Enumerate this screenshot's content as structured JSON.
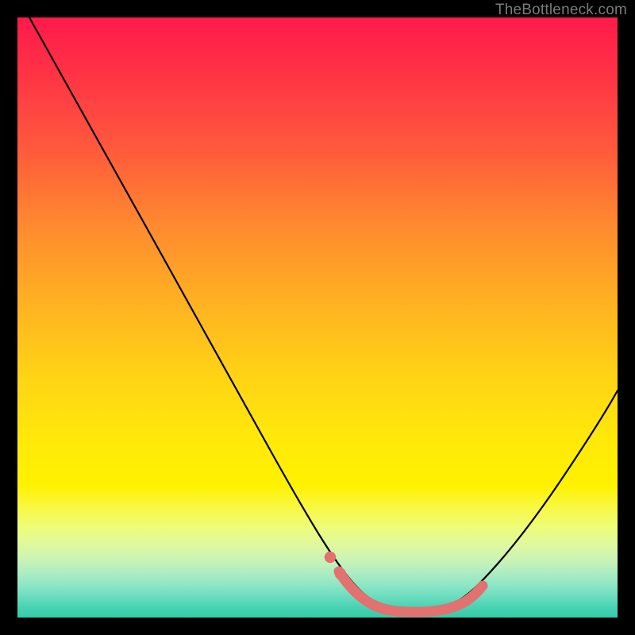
{
  "watermark": {
    "text": "TheBottleneck.com"
  },
  "colors": {
    "background": "#000000",
    "curve": "#000000",
    "highlight": "#e2716f",
    "watermark": "#88898a"
  },
  "chart_data": {
    "type": "line",
    "title": "",
    "xlabel": "",
    "ylabel": "",
    "xlim": [
      0,
      100
    ],
    "ylim": [
      0,
      100
    ],
    "grid": false,
    "legend": false,
    "series": [
      {
        "name": "bottleneck-curve",
        "x": [
          2,
          6,
          10,
          14,
          18,
          22,
          26,
          30,
          34,
          38,
          42,
          46,
          50,
          54,
          58,
          60,
          62,
          64,
          66,
          70,
          74,
          78,
          82,
          86,
          90,
          94,
          98,
          100
        ],
        "y": [
          100,
          94,
          87,
          80,
          73,
          66,
          59,
          52,
          45,
          38,
          31,
          24,
          18,
          12,
          7,
          5,
          3,
          2,
          1,
          1,
          2,
          5,
          10,
          17,
          25,
          34,
          43,
          48
        ]
      }
    ],
    "highlighted_region": {
      "x": [
        52,
        54,
        56,
        58,
        60,
        62,
        66,
        70,
        74,
        76
      ],
      "y": [
        12,
        9,
        7,
        5,
        4,
        2,
        1,
        1,
        2,
        4
      ]
    }
  }
}
